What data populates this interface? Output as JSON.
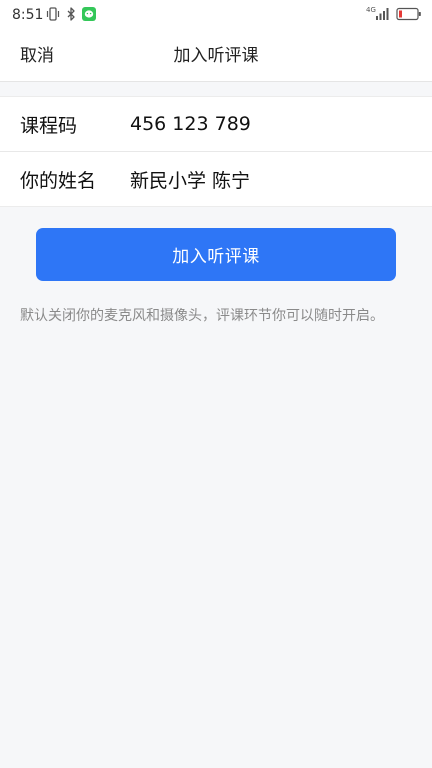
{
  "status_bar": {
    "time": "8:51",
    "network": "4G",
    "icons_left": [
      "vibrate-icon",
      "bluetooth-icon",
      "wechat-icon"
    ],
    "icons_right": [
      "signal-icon",
      "battery-icon"
    ],
    "colors": {
      "wechat": "#34c759",
      "battery_low": "#e53935"
    }
  },
  "nav": {
    "cancel_label": "取消",
    "title": "加入听评课"
  },
  "form": {
    "course_code_label": "课程码",
    "course_code_value": "456 123 789",
    "name_label": "你的姓名",
    "name_value": "新民小学 陈宁"
  },
  "join_button_label": "加入听评课",
  "hint": "默认关闭你的麦克风和摄像头，评课环节你可以随时开启。",
  "colors": {
    "accent": "#2e76f6",
    "background": "#f6f7f9"
  }
}
